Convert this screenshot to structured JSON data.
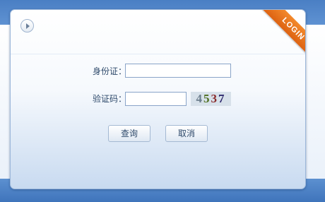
{
  "header": {
    "badge_label": "LOGIN"
  },
  "form": {
    "id_label": "身份证：",
    "id_value": "",
    "code_label": "验证码：",
    "code_value": "",
    "captcha_digits": [
      "4",
      "5",
      "3",
      "7"
    ]
  },
  "buttons": {
    "query_label": "查询",
    "cancel_label": "取消"
  },
  "colors": {
    "accent_blue": "#4a7fc4",
    "badge_orange": "#e8731c"
  }
}
